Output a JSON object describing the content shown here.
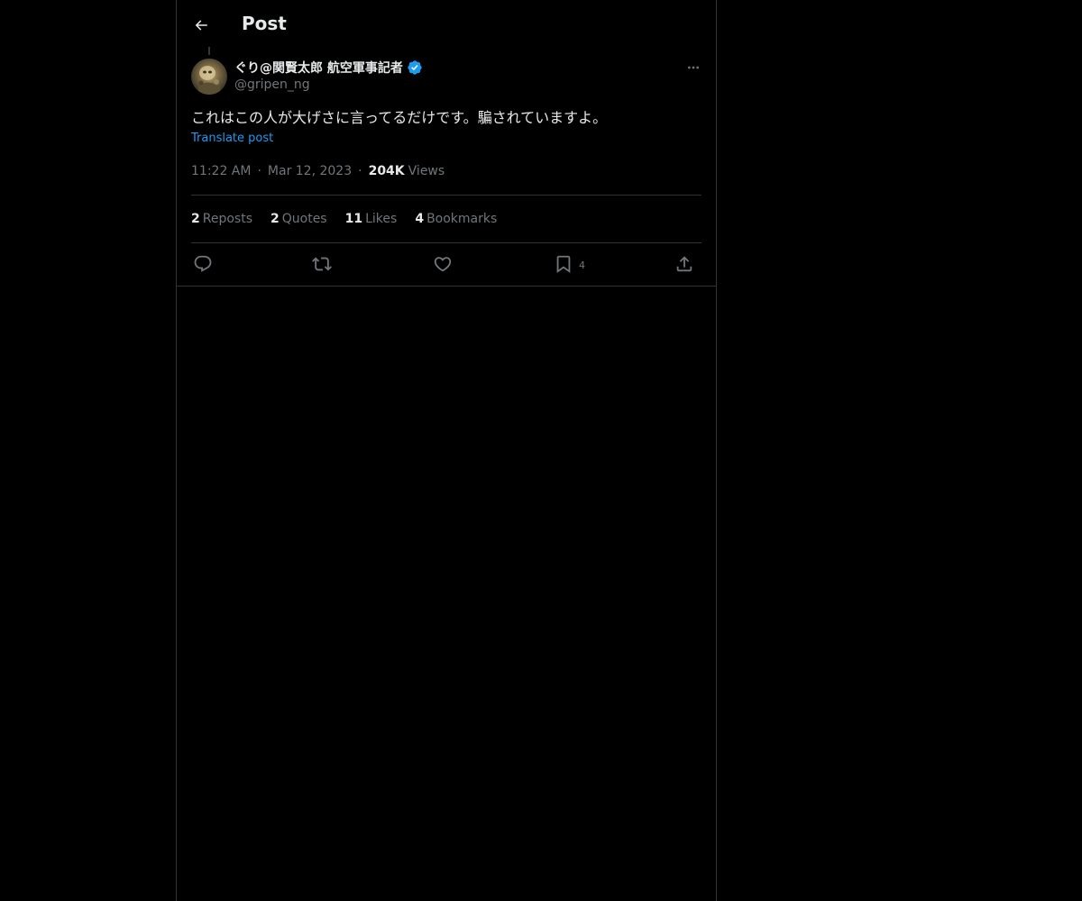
{
  "header": {
    "title": "Post",
    "back_icon": "arrow-left-icon"
  },
  "post": {
    "author": {
      "display_name": "ぐり@関賢太郎 航空軍事記者",
      "handle": "@gripen_ng",
      "verified": true,
      "verified_color": "#1d9bf0"
    },
    "text": "これはこの人が大げさに言ってるだけです。騙されていますよ。",
    "translate_label": "Translate post",
    "time": "11:22 AM",
    "date": "Mar 12, 2023",
    "separator": "·",
    "views_count": "204K",
    "views_label": "Views"
  },
  "stats": [
    {
      "count": "2",
      "label": "Reposts"
    },
    {
      "count": "2",
      "label": "Quotes"
    },
    {
      "count": "11",
      "label": "Likes"
    },
    {
      "count": "4",
      "label": "Bookmarks"
    }
  ],
  "actions": {
    "reply_icon": "reply-icon",
    "repost_icon": "repost-icon",
    "like_icon": "like-icon",
    "bookmark_icon": "bookmark-icon",
    "bookmark_count": "4",
    "share_icon": "share-icon"
  },
  "colors": {
    "background": "#000000",
    "text_primary": "#e7e9ea",
    "text_secondary": "#71767b",
    "accent": "#1d9bf0",
    "border": "#2f3336"
  }
}
